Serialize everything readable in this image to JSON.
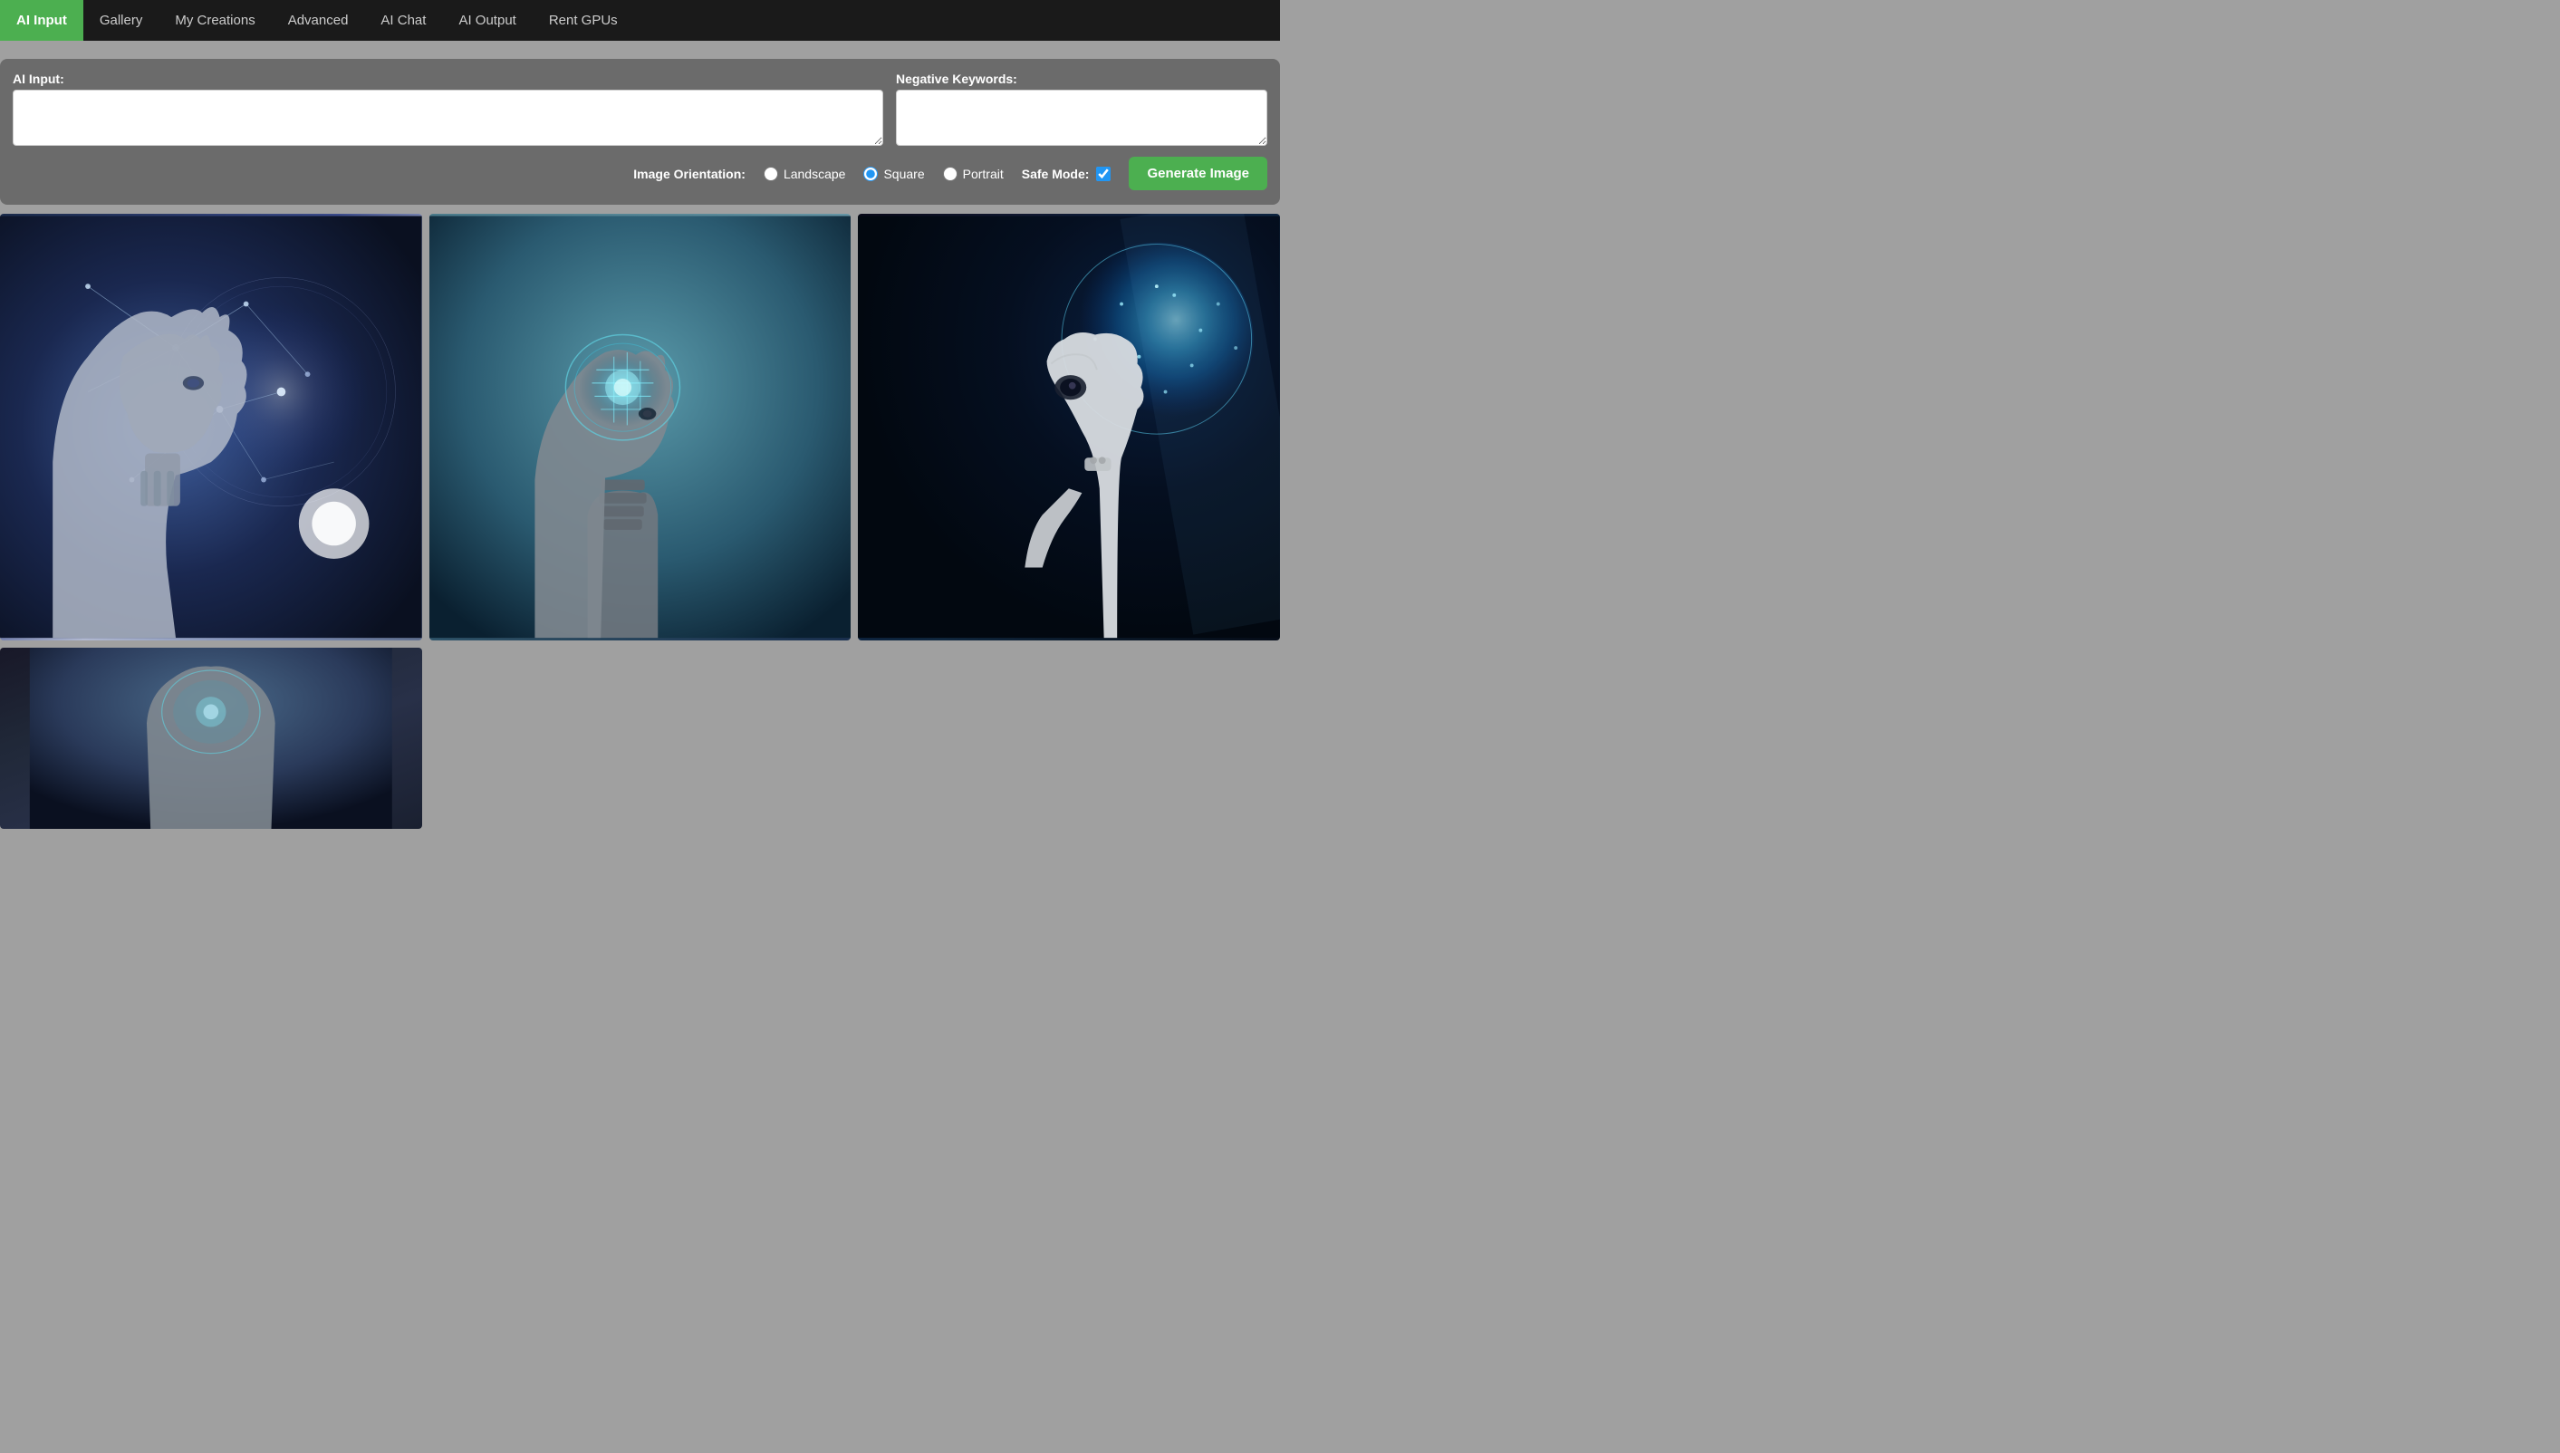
{
  "nav": {
    "items": [
      {
        "id": "ai-input",
        "label": "AI Input",
        "active": true
      },
      {
        "id": "gallery",
        "label": "Gallery",
        "active": false
      },
      {
        "id": "my-creations",
        "label": "My Creations",
        "active": false
      },
      {
        "id": "advanced",
        "label": "Advanced",
        "active": false
      },
      {
        "id": "ai-chat",
        "label": "AI Chat",
        "active": false
      },
      {
        "id": "ai-output",
        "label": "AI Output",
        "active": false
      },
      {
        "id": "rent-gpus",
        "label": "Rent GPUs",
        "active": false
      }
    ]
  },
  "controls": {
    "ai_input_label": "AI Input:",
    "ai_input_placeholder": "",
    "ai_input_value": "",
    "negative_keywords_label": "Negative Keywords:",
    "negative_keywords_placeholder": "",
    "negative_keywords_value": "",
    "orientation_label": "Image Orientation:",
    "orientations": [
      {
        "id": "landscape",
        "label": "Landscape",
        "checked": false
      },
      {
        "id": "square",
        "label": "Square",
        "checked": true
      },
      {
        "id": "portrait",
        "label": "Portrait",
        "checked": false
      }
    ],
    "safe_mode_label": "Safe Mode:",
    "safe_mode_checked": true,
    "generate_button_label": "Generate Image"
  },
  "gallery": {
    "images": [
      {
        "id": "img-1",
        "alt": "AI robot head with neural network overlay"
      },
      {
        "id": "img-2",
        "alt": "AI robot head with glowing brain circuit"
      },
      {
        "id": "img-3",
        "alt": "White AI robot with blue energy sphere"
      },
      {
        "id": "img-4",
        "alt": "AI robot bottom partial"
      }
    ]
  }
}
